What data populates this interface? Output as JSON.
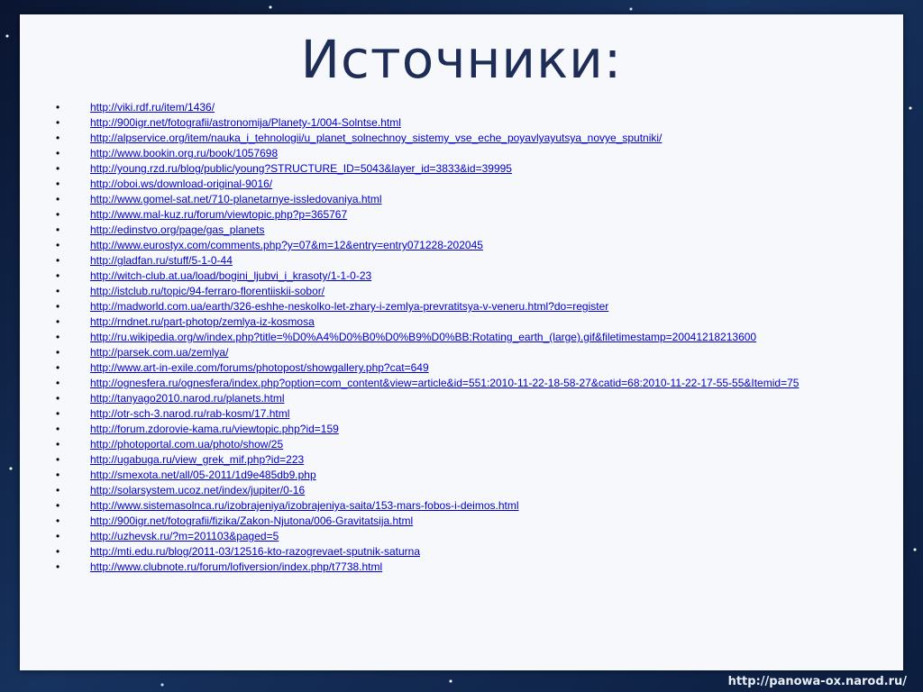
{
  "slide": {
    "title": "Источники:",
    "bullet_char": "•",
    "sources": [
      "http://viki.rdf.ru/item/1436/",
      "http://900igr.net/fotografii/astronomija/Planety-1/004-Solntse.html",
      "http://alpservice.org/item/nauka_i_tehnologii/u_planet_solnechnoy_sistemy_vse_eche_poyavlyayutsya_novye_sputniki/",
      "http://www.bookin.org.ru/book/1057698",
      "http://young.rzd.ru/blog/public/young?STRUCTURE_ID=5043&layer_id=3833&id=39995",
      "http://oboi.ws/download-original-9016/",
      "http://www.gomel-sat.net/710-planetarnye-issledovaniya.html",
      "http://www.mal-kuz.ru/forum/viewtopic.php?p=365767",
      "http://edinstvo.org/page/gas_planets",
      "http://www.eurostyx.com/comments.php?y=07&m=12&entry=entry071228-202045",
      "http://gladfan.ru/stuff/5-1-0-44",
      "http://witch-club.at.ua/load/bogini_ljubvi_i_krasoty/1-1-0-23",
      "http://istclub.ru/topic/94-ferraro-florentiiskii-sobor/",
      "http://madworld.com.ua/earth/326-eshhe-neskolko-let-zhary-i-zemlya-prevratitsya-v-veneru.html?do=register",
      "http://rndnet.ru/part-photop/zemlya-iz-kosmosa",
      "http://ru.wikipedia.org/w/index.php?title=%D0%A4%D0%B0%D0%B9%D0%BB:Rotating_earth_(large).gif&filetimestamp=20041218213600",
      "http://parsek.com.ua/zemlya/",
      "http://www.art-in-exile.com/forums/photopost/showgallery.php?cat=649",
      "http://ognesfera.ru/ognesfera/index.php?option=com_content&view=article&id=551:2010-11-22-18-58-27&catid=68:2010-11-22-17-55-55&Itemid=75",
      "http://tanyago2010.narod.ru/planets.html",
      "http://otr-sch-3.narod.ru/rab-kosm/17.html",
      "http://forum.zdorovie-kama.ru/viewtopic.php?id=159",
      "http://photoportal.com.ua/photo/show/25",
      "http://ugabuga.ru/view_grek_mif.php?id=223",
      "http://smexota.net/all/05-2011/1d9e485db9.php",
      "http://solarsystem.ucoz.net/index/jupiter/0-16",
      "http://www.sistemasolnca.ru/izobrajeniya/izobrajeniya-saita/153-mars-fobos-i-deimos.html",
      "http://900igr.net/fotografii/fizika/Zakon-Njutona/006-Gravitatsija.html",
      "http://uzhevsk.ru/?m=201103&paged=5",
      "http://mti.edu.ru/blog/2011-03/12516-kto-razogrevaet-sputnik-saturna",
      "http://www.clubnote.ru/forum/lofiversion/index.php/t7738.html"
    ]
  },
  "footer": {
    "url": "http://panowa-ox.narod.ru/"
  },
  "colors": {
    "title": "#1d2d55",
    "link": "#0000cc",
    "slide_background": "#f7f8fb",
    "space_background": "#0b1a38"
  }
}
